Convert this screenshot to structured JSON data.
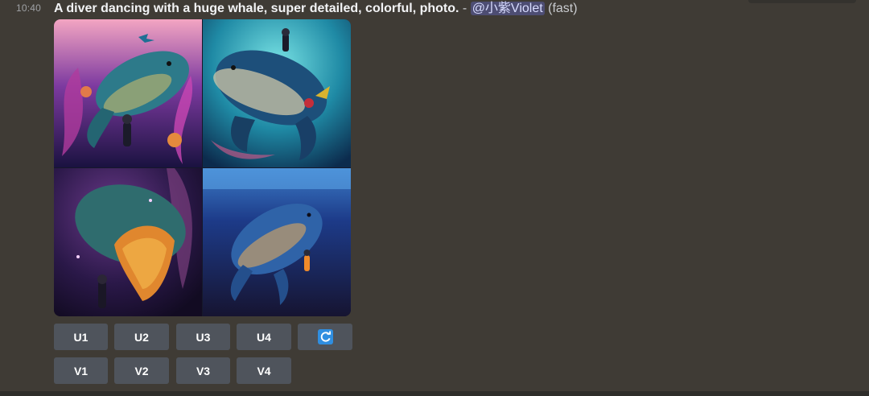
{
  "message": {
    "timestamp": "10:40",
    "prompt": "A diver dancing with a huge whale, super detailed, colorful, photo.",
    "separator": " - ",
    "mention": "@小紫Violet",
    "speed": "(fast)"
  },
  "image": {
    "alt": "Four-panel grid of a diver with a huge whale"
  },
  "buttons": {
    "upscale": [
      "U1",
      "U2",
      "U3",
      "U4"
    ],
    "variation": [
      "V1",
      "V2",
      "V3",
      "V4"
    ],
    "reroll_icon": "refresh-icon"
  },
  "colors": {
    "background": "#3f3b35",
    "button": "#4f545c",
    "mention_bg": "#4d4d73",
    "refresh_accent": "#2f8ee0"
  }
}
